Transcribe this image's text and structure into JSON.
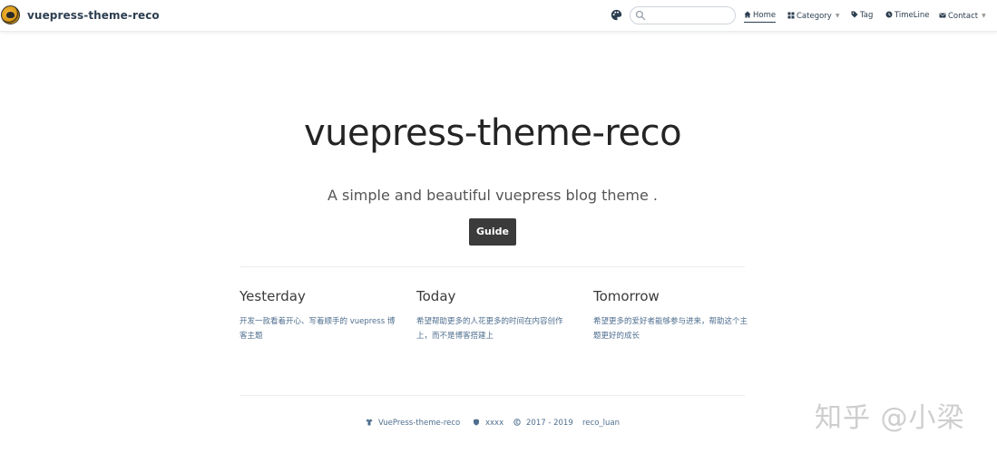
{
  "navbar": {
    "site_name": "vuepress-theme-reco",
    "search": {
      "placeholder": "",
      "value": ""
    },
    "items": [
      {
        "label": "Home",
        "icon": "home-icon",
        "active": true
      },
      {
        "label": "Category",
        "icon": "category-icon",
        "dropdown": true
      },
      {
        "label": "Tag",
        "icon": "tag-icon"
      },
      {
        "label": "TimeLine",
        "icon": "timeline-icon"
      },
      {
        "label": "Contact",
        "icon": "contact-icon",
        "dropdown": true
      }
    ]
  },
  "hero": {
    "title": "vuepress-theme-reco",
    "description": "A simple and beautiful vuepress blog theme .",
    "action_label": "Guide"
  },
  "features": [
    {
      "title": "Yesterday",
      "details": "开发一款看着开心、写着顺手的 vuepress 博客主题"
    },
    {
      "title": "Today",
      "details": "希望帮助更多的人花更多的时间在内容创作上，而不是博客搭建上"
    },
    {
      "title": "Tomorrow",
      "details": "希望更多的爱好者能够参与进来，帮助这个主题更好的成长"
    }
  ],
  "footer": {
    "theme": "VuePress-theme-reco",
    "icp": "xxxx",
    "years": "2017 - 2019",
    "author": "reco_luan"
  },
  "watermark": "知乎 @小梁",
  "colors": {
    "text": "#2c3e50",
    "button": "#3b3b3b",
    "muted": "#4e6e8e"
  }
}
